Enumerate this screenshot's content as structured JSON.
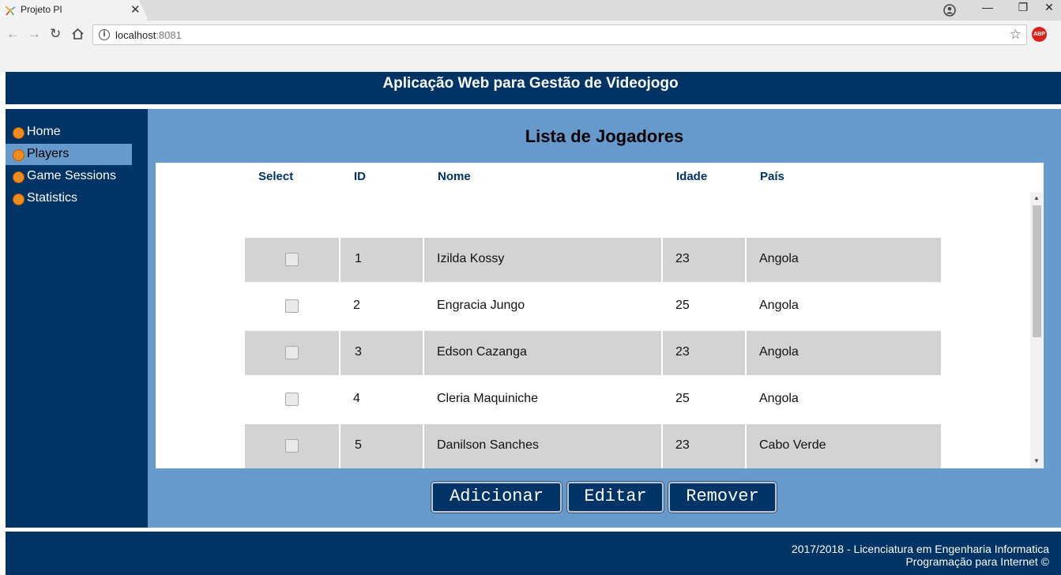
{
  "browser": {
    "tab_title": "Projeto PI",
    "tab_close": "✕",
    "url_host": "localhost",
    "url_port": ":8081",
    "abp_label": "ABP",
    "controls": {
      "minimize": "—",
      "restore": "❐",
      "close": "✕"
    },
    "icons": [
      "back-icon",
      "forward-icon",
      "reload-icon",
      "home-icon",
      "info-icon",
      "star-icon",
      "adblock-icon",
      "profile-icon"
    ]
  },
  "header": {
    "title": "Aplicação Web para Gestão de Videojogo"
  },
  "sidebar": {
    "items": [
      {
        "label": "Home",
        "active": false
      },
      {
        "label": "Players",
        "active": true
      },
      {
        "label": "Game Sessions",
        "active": false
      },
      {
        "label": "Statistics",
        "active": false
      }
    ]
  },
  "main": {
    "title": "Lista de Jogadores",
    "columns": [
      "Select",
      "ID",
      "Nome",
      "Idade",
      "País"
    ],
    "rows": [
      {
        "id": "1",
        "nome": "Izilda Kossy",
        "idade": "23",
        "pais": "Angola",
        "checked": false
      },
      {
        "id": "2",
        "nome": "Engracia Jungo",
        "idade": "25",
        "pais": "Angola",
        "checked": false
      },
      {
        "id": "3",
        "nome": "Edson Cazanga",
        "idade": "23",
        "pais": "Angola",
        "checked": false
      },
      {
        "id": "4",
        "nome": "Cleria Maquiniche",
        "idade": "25",
        "pais": "Angola",
        "checked": false
      },
      {
        "id": "5",
        "nome": "Danilson Sanches",
        "idade": "23",
        "pais": "Cabo Verde",
        "checked": false
      }
    ],
    "buttons": {
      "add": "Adicionar",
      "edit": "Editar",
      "remove": "Remover"
    }
  },
  "footer": {
    "line1": "2017/2018 - Licenciatura em Engenharia Informatica",
    "line2": "Programação para Internet ©"
  },
  "colors": {
    "brand": "#003366",
    "content_bg": "#6699cc",
    "row_shade": "#d3d3d3",
    "bullet": "#f08c1e"
  }
}
